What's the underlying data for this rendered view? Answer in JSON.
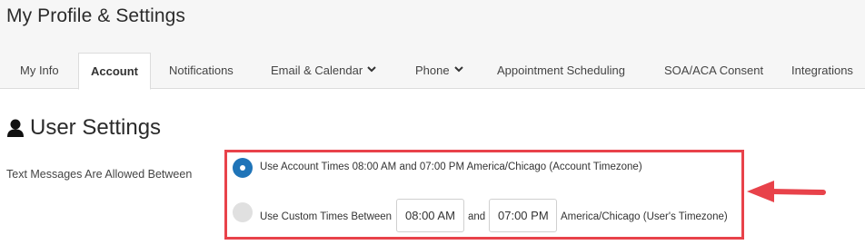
{
  "page": {
    "title": "My Profile & Settings"
  },
  "tabs": [
    {
      "label": "My Info",
      "active": false,
      "dropdown": false
    },
    {
      "label": "Account",
      "active": true,
      "dropdown": false
    },
    {
      "label": "Notifications",
      "active": false,
      "dropdown": false
    },
    {
      "label": "Email & Calendar",
      "active": false,
      "dropdown": true
    },
    {
      "label": "Phone",
      "active": false,
      "dropdown": true
    },
    {
      "label": "Appointment Scheduling",
      "active": false,
      "dropdown": false
    },
    {
      "label": "SOA/ACA Consent",
      "active": false,
      "dropdown": false
    },
    {
      "label": "Integrations",
      "active": false,
      "dropdown": false
    }
  ],
  "section": {
    "title": "User Settings",
    "icon": "user-icon"
  },
  "text_messages": {
    "label": "Text Messages Are Allowed Between",
    "option_account": {
      "selected": true,
      "prefix": "Use Account Times",
      "start": "08:00 AM",
      "and": "and",
      "end": "07:00 PM",
      "timezone": "America/Chicago (Account Timezone)"
    },
    "option_custom": {
      "selected": false,
      "prefix": "Use Custom Times Between",
      "start_value": "08:00 AM",
      "and": "and",
      "end_value": "07:00 PM",
      "timezone": "America/Chicago (User's Timezone)"
    }
  },
  "colors": {
    "accent": "#1f74b8",
    "highlight": "#e8424a",
    "header_bg": "#f6f6f6"
  }
}
